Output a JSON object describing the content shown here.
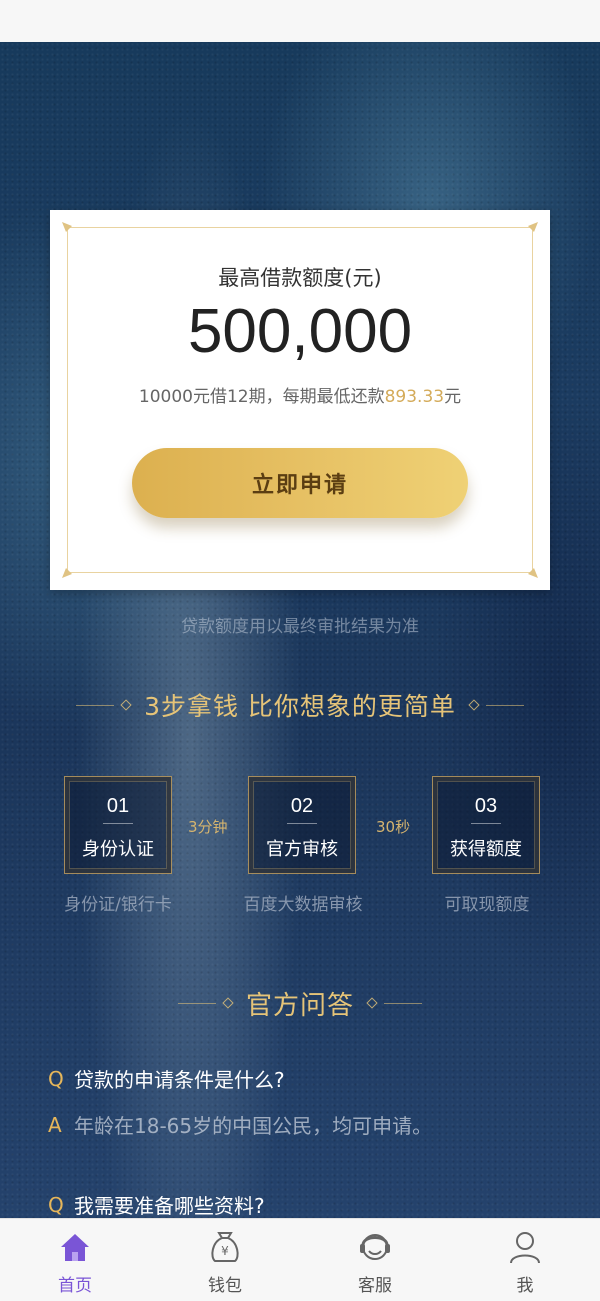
{
  "loan_card": {
    "title": "最高借款额度(元)",
    "amount": "500,000",
    "note_prefix": "10000元借12期，每期最低还款",
    "note_highlight": "893.33",
    "note_suffix": "元",
    "apply_label": "立即申请"
  },
  "disclaimer": "贷款额度用以最终审批结果为准",
  "steps_section": {
    "heading": "3步拿钱 比你想象的更简单",
    "steps": [
      {
        "number": "01",
        "label": "身份认证",
        "desc": "身份证/银行卡"
      },
      {
        "number": "02",
        "label": "官方审核",
        "desc": "百度大数据审核"
      },
      {
        "number": "03",
        "label": "获得额度",
        "desc": "可取现额度"
      }
    ],
    "times": [
      "3分钟",
      "30秒"
    ]
  },
  "qa_section": {
    "heading": "官方问答",
    "q_mark": "Q",
    "a_mark": "A",
    "items": [
      {
        "question": "贷款的申请条件是什么?",
        "answer": "年龄在18-65岁的中国公民，均可申请。"
      },
      {
        "question": "我需要准备哪些资料?"
      }
    ]
  },
  "bottom_nav": {
    "items": [
      {
        "label": "首页",
        "icon": "home-icon",
        "active": true
      },
      {
        "label": "钱包",
        "icon": "wallet-icon",
        "active": false
      },
      {
        "label": "客服",
        "icon": "customer-service-icon",
        "active": false
      },
      {
        "label": "我",
        "icon": "profile-icon",
        "active": false
      }
    ]
  },
  "colors": {
    "accent_gold": "#e6c478",
    "active_nav": "#7a55d6",
    "background_navy": "#1b3b60"
  }
}
